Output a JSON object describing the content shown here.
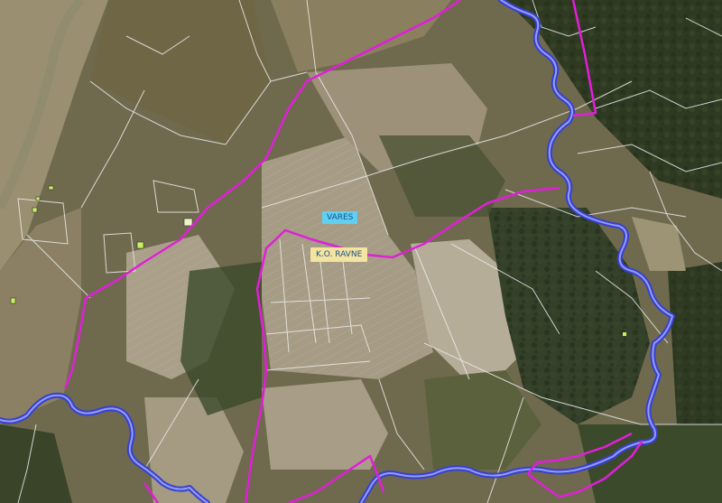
{
  "map": {
    "labels": {
      "settlement": "VARES",
      "cadastral_municipality": "K.O. RAVNE"
    },
    "colors": {
      "terrain_base": "#6f6a4e",
      "field_light": "#a59a82",
      "forest": "#2f3a22",
      "boundary": "#e01fd8",
      "river": "#3b3ed0",
      "parcel_line": "#ececec",
      "settlement_label_bg": "#5fd0f2",
      "cadastral_label_bg": "#f3e4a0",
      "building": "#c8f060"
    },
    "layers": [
      "satellite-imagery",
      "parcel-boundaries",
      "cadastral-boundary",
      "river"
    ]
  }
}
